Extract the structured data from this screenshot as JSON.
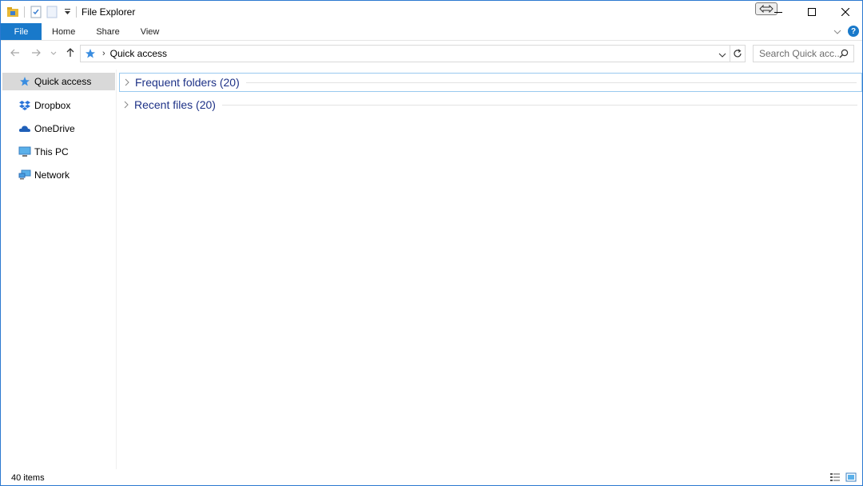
{
  "window": {
    "title": "File Explorer"
  },
  "ribbon": {
    "tabs": [
      {
        "label": "File"
      },
      {
        "label": "Home"
      },
      {
        "label": "Share"
      },
      {
        "label": "View"
      }
    ],
    "help_label": "?"
  },
  "address": {
    "path": "Quick access",
    "search_placeholder": "Search Quick acc..."
  },
  "navpane": {
    "items": [
      {
        "label": "Quick access",
        "icon": "quick-access-star-icon",
        "selected": true
      },
      {
        "label": "Dropbox",
        "icon": "dropbox-icon"
      },
      {
        "label": "OneDrive",
        "icon": "onedrive-cloud-icon"
      },
      {
        "label": "This PC",
        "icon": "computer-icon"
      },
      {
        "label": "Network",
        "icon": "network-icon"
      }
    ]
  },
  "content": {
    "groups": [
      {
        "title": "Frequent folders (20)",
        "expanded": false
      },
      {
        "title": "Recent files (20)",
        "expanded": false
      }
    ]
  },
  "status": {
    "item_count": "40 items"
  },
  "colors": {
    "accent": "#1979ca",
    "group_title": "#1e3287",
    "selected_bg": "#d9d9d9"
  }
}
